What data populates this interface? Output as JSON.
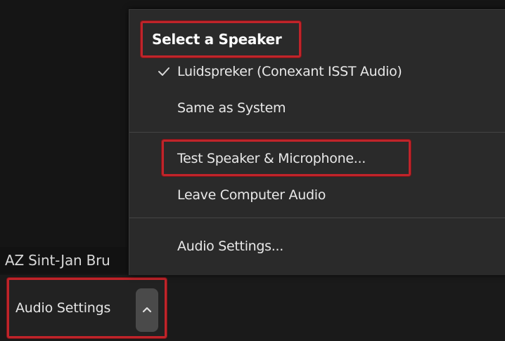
{
  "participant": {
    "name_label": "AZ Sint-Jan Bru"
  },
  "toolbar": {
    "audio_settings_label": "Audio Settings"
  },
  "menu": {
    "header": "Select a Speaker",
    "speakers": [
      {
        "label": "Luidspreker (Conexant ISST Audio)",
        "checked": true
      },
      {
        "label": "Same as System",
        "checked": false
      }
    ],
    "actions": [
      {
        "label": "Test Speaker & Microphone..."
      },
      {
        "label": "Leave Computer Audio"
      }
    ],
    "footer": [
      {
        "label": "Audio Settings..."
      }
    ]
  },
  "icons": {
    "checkmark": "checkmark-icon",
    "chevron": "chevron-up-icon"
  },
  "colors": {
    "highlight_red": "#c0242a",
    "menu_bg": "#2a2a2a",
    "toolbar_bg": "#1a1a1a",
    "video_bg": "#151515"
  }
}
